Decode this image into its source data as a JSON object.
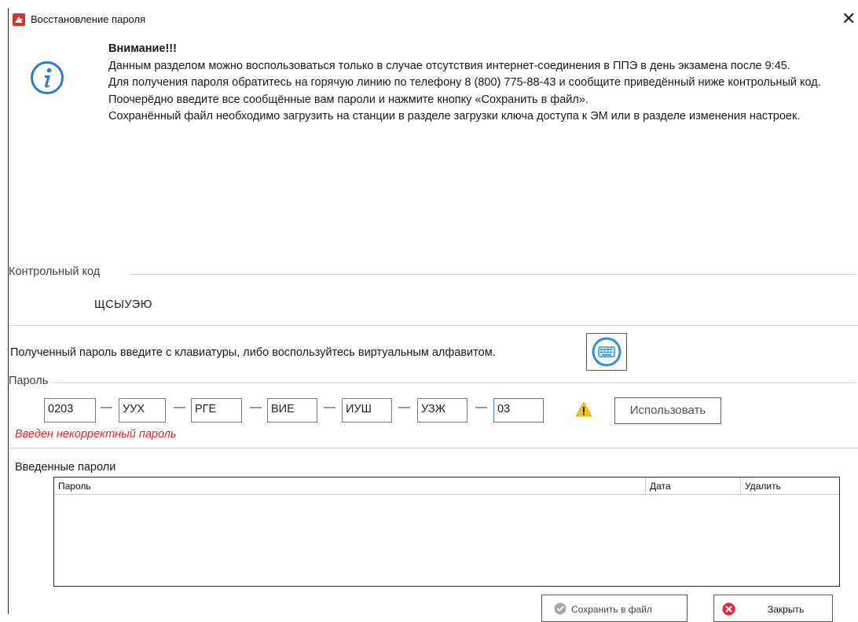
{
  "window": {
    "title": "Восстановление пароля",
    "close_glyph": "✕"
  },
  "notice": {
    "heading": "Внимание!!!",
    "lines": [
      "Данным разделом можно воспользоваться только в случае отсутствия интернет-соединения в ППЭ в день экзамена после 9:45.",
      "Для получения пароля обратитесь на горячую линию по телефону 8 (800) 775-88-43 и сообщите приведённый ниже контрольный код.",
      "Поочерёдно введите все сообщённые вам пароли и нажмите кнопку «Сохранить в файл».",
      "Сохранённый файл необходимо загрузить на станции в разделе загрузки ключа доступа к ЭМ или в разделе изменения настроек."
    ]
  },
  "control_code": {
    "label": "Контрольный код",
    "value": "ЩСЫУЭЮ"
  },
  "virtual_keyboard": {
    "hint": "Полученный пароль введите с клавиатуры, либо воспользуйтесь виртуальным алфавитом.",
    "icon": "keyboard-icon"
  },
  "password": {
    "label": "Пароль",
    "fields": [
      "0203",
      "УУХ",
      "РГЕ",
      "ВИЕ",
      "ИУШ",
      "УЗЖ",
      "03"
    ],
    "separator": "—",
    "use_button": "Использовать",
    "error": "Введен некорректный пароль"
  },
  "entered": {
    "label": "Введенные пароли",
    "columns": [
      "Пароль",
      "Дата",
      "Удалить"
    ],
    "rows": []
  },
  "buttons": {
    "save": "Сохранить в файл",
    "close": "Закрыть"
  },
  "colors": {
    "accent": "#3b7fd4",
    "error": "#e0272b",
    "warning": "#f3c21b",
    "close_icon": "#e8283a",
    "disabled_icon": "#a8a8a8"
  }
}
